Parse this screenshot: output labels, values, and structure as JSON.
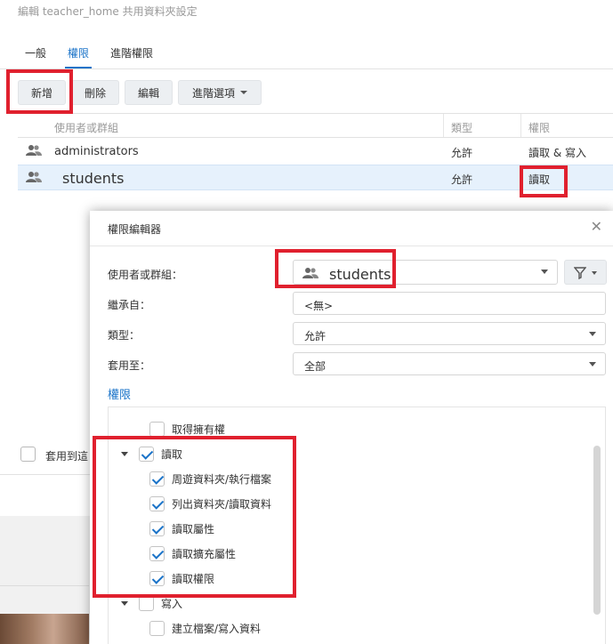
{
  "window": {
    "title": "編輯 teacher_home 共用資料夾設定",
    "tabs": [
      "一般",
      "權限",
      "進階權限"
    ],
    "active_tab": 1
  },
  "toolbar": {
    "create_label": "新增",
    "delete_label": "刪除",
    "edit_label": "編輯",
    "advanced_label": "進階選項"
  },
  "grid": {
    "columns": [
      "使用者或群組",
      "類型",
      "權限"
    ],
    "rows": [
      {
        "name": "administrators",
        "type": "允許",
        "permission": "讀取 & 寫入",
        "selected": false
      },
      {
        "name": "students",
        "type": "允許",
        "permission": "讀取",
        "selected": true
      }
    ]
  },
  "apply_subfolders_label": "套用到這",
  "dialog": {
    "title": "權限編輯器",
    "close_glyph": "✕",
    "user_label": "使用者或群組：",
    "user_value": "students",
    "inherit_label": "繼承自：",
    "inherit_value": "<無>",
    "type_label": "類型：",
    "type_value": "允許",
    "apply_label": "套用至：",
    "apply_value": "全部",
    "permissions_heading": "權限",
    "permissions": [
      {
        "label": "取得擁有權",
        "checked": false,
        "level": 1
      },
      {
        "label": "讀取",
        "checked": true,
        "level": 0,
        "group": true
      },
      {
        "label": "周遊資料夾/執行檔案",
        "checked": true,
        "level": 1
      },
      {
        "label": "列出資料夾/讀取資料",
        "checked": true,
        "level": 1
      },
      {
        "label": "讀取屬性",
        "checked": true,
        "level": 1
      },
      {
        "label": "讀取擴充屬性",
        "checked": true,
        "level": 1
      },
      {
        "label": "讀取權限",
        "checked": true,
        "level": 1
      },
      {
        "label": "寫入",
        "checked": false,
        "level": 0,
        "group": true
      },
      {
        "label": "建立檔案/寫入資料",
        "checked": false,
        "level": 1
      }
    ]
  },
  "colors": {
    "accent": "#1a73c8",
    "highlight": "#e0202e",
    "selected_row": "#e6f1fc"
  },
  "icons": {
    "user_group": "user-group-icon",
    "filter": "filter-icon",
    "close": "close-icon",
    "expand": "caret-down-icon"
  }
}
